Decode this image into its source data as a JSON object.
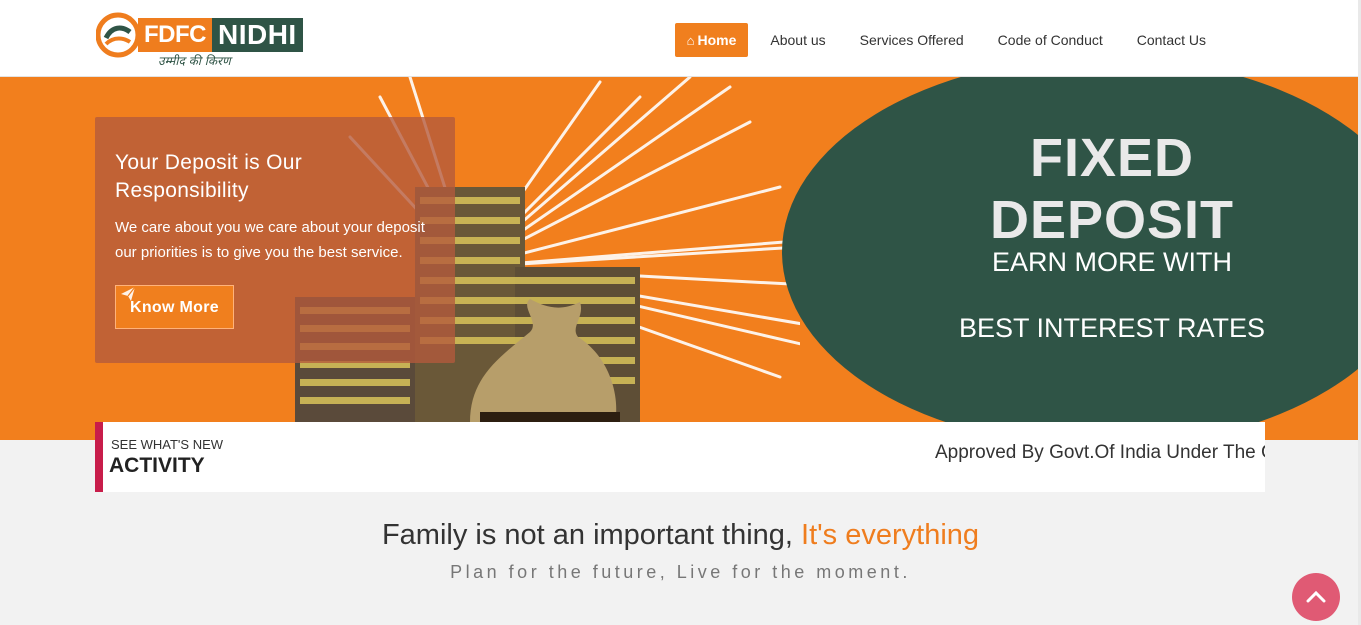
{
  "brand": {
    "logo_left": "FDFC",
    "logo_right": "NIDHI",
    "tagline": "उम्मीद की किरण"
  },
  "nav": {
    "items": [
      {
        "label": "Home",
        "icon": "home-icon",
        "active": true
      },
      {
        "label": "About us",
        "active": false
      },
      {
        "label": "Services Offered",
        "active": false
      },
      {
        "label": "Code of Conduct",
        "active": false
      },
      {
        "label": "Contact Us",
        "active": false
      }
    ]
  },
  "banner": {
    "promo_title": "Your Deposit is Our Responsibility",
    "promo_text": "We care about you we care about your deposit our priorities is to give you the best service.",
    "promo_button": "Know More",
    "promo_button_icon": "paper-plane-icon",
    "headline": "FIXED DEPOSIT",
    "line1": "EARN MORE WITH",
    "line2": "BEST INTEREST RATES"
  },
  "ticker": {
    "small": "SEE WHAT'S NEW",
    "big": "ACTIVITY",
    "scroll_text": "Approved By Govt.Of India Under The Gu"
  },
  "intro": {
    "heading_main": "Family is not an important thing, ",
    "heading_accent": "It's everything",
    "subheading": "Plan for the future, Live for the moment."
  },
  "back_to_top_icon": "chevron-up-icon",
  "colors": {
    "brand_orange": "#f07f1e",
    "brand_green": "#2f5446",
    "ticker_accent": "#c81d4a",
    "to_top": "#e05a74"
  }
}
